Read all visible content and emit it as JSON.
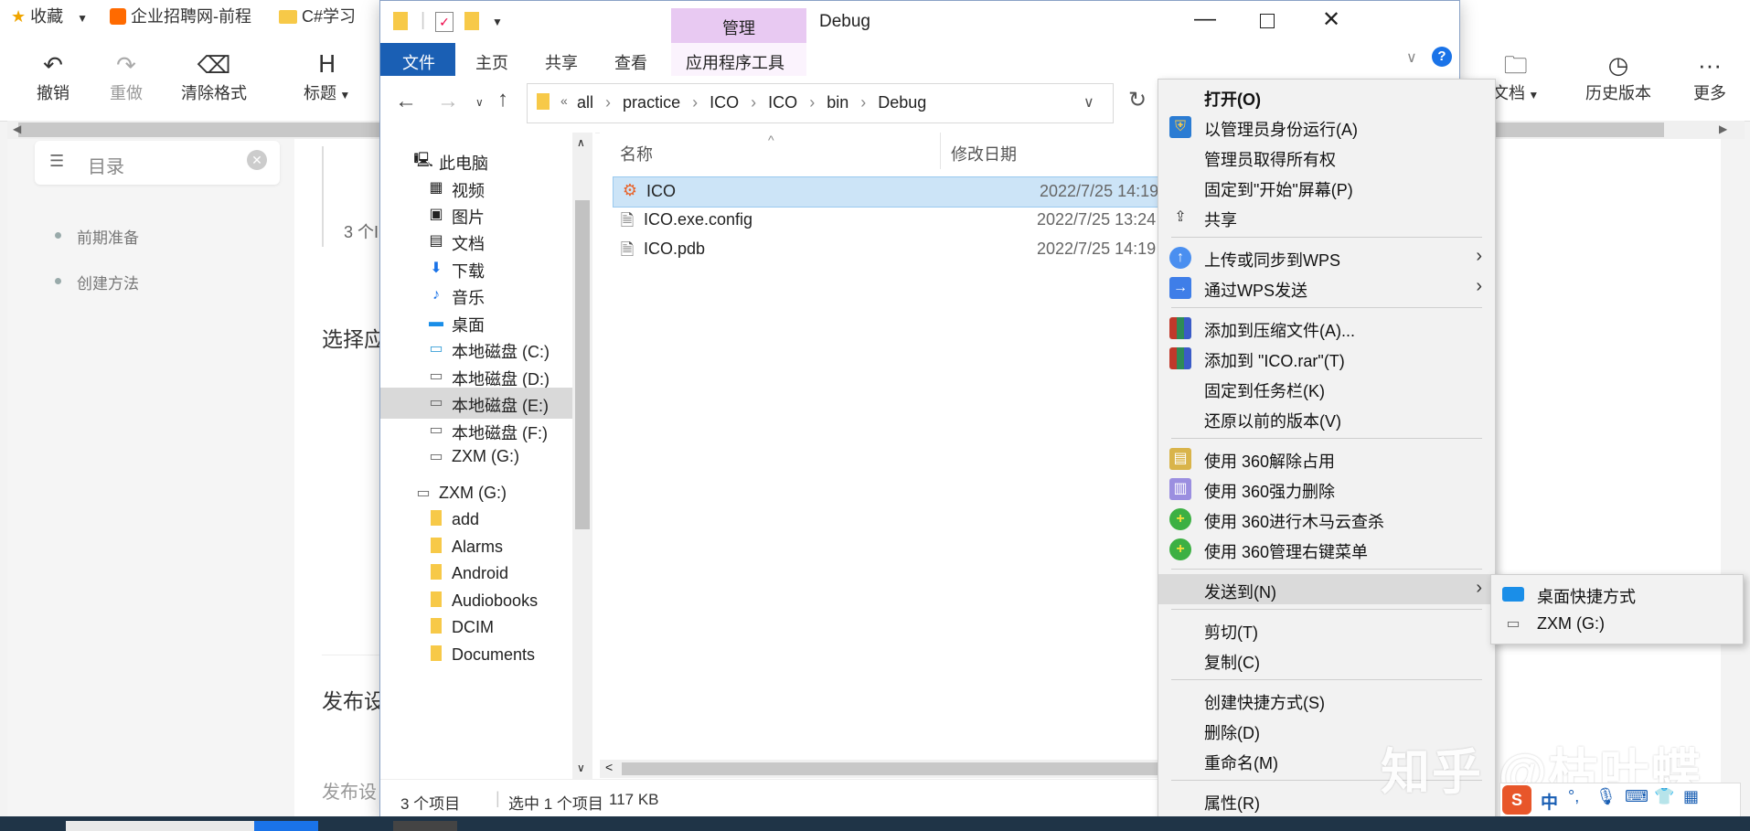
{
  "bookmarks": {
    "items": [
      {
        "label": "收藏",
        "icon": "star-icon"
      },
      {
        "label": "企业招聘网-前程",
        "icon": "job-site-icon"
      },
      {
        "label": "C#学习",
        "icon": "folder-icon"
      }
    ]
  },
  "editor_toolbar": {
    "undo": "撤销",
    "redo": "重做",
    "clear_format": "清除格式",
    "heading": "标题",
    "docs": "文档",
    "history": "历史版本",
    "more": "更多"
  },
  "toc": {
    "label": "目录",
    "items": [
      "前期准备",
      "创建方法"
    ]
  },
  "doc": {
    "count_fragment": "3 个I",
    "select_fragment": "选择应",
    "publish_fragment": "发布设",
    "publish_fragment2": "发布设"
  },
  "explorer": {
    "title": "Debug",
    "context_tab_header": "管理",
    "ribbon_tabs": [
      "文件",
      "主页",
      "共享",
      "查看",
      "应用程序工具"
    ],
    "breadcrumb": [
      "all",
      "practice",
      "ICO",
      "ICO",
      "bin",
      "Debug"
    ],
    "breadcrumb_prefix": "«",
    "nav": {
      "this_pc": "此电脑",
      "items": [
        {
          "label": "视频",
          "icon": "video-icon"
        },
        {
          "label": "图片",
          "icon": "pictures-icon"
        },
        {
          "label": "文档",
          "icon": "documents-icon"
        },
        {
          "label": "下载",
          "icon": "download-icon"
        },
        {
          "label": "音乐",
          "icon": "music-icon"
        },
        {
          "label": "桌面",
          "icon": "desktop-icon"
        },
        {
          "label": "本地磁盘 (C:)",
          "icon": "drive-c-icon"
        },
        {
          "label": "本地磁盘 (D:)",
          "icon": "drive-icon"
        },
        {
          "label": "本地磁盘 (E:)",
          "icon": "drive-icon",
          "selected": true
        },
        {
          "label": "本地磁盘 (F:)",
          "icon": "drive-icon"
        },
        {
          "label": "ZXM (G:)",
          "icon": "usb-drive-icon"
        }
      ],
      "zxm_root": "ZXM (G:)",
      "folders": [
        "add",
        "Alarms",
        "Android",
        "Audiobooks",
        "DCIM",
        "Documents"
      ]
    },
    "columns": {
      "name": "名称",
      "modified": "修改日期"
    },
    "files": [
      {
        "name": "ICO",
        "date": "2022/7/25 14:19",
        "icon": "exe-gear-icon",
        "selected": true
      },
      {
        "name": "ICO.exe.config",
        "date": "2022/7/25 13:24",
        "icon": "config-file-icon"
      },
      {
        "name": "ICO.pdb",
        "date": "2022/7/25 14:19",
        "icon": "pdb-file-icon"
      }
    ],
    "status": {
      "count": "3 个项目",
      "selected": "选中 1 个项目",
      "size": "117 KB"
    }
  },
  "context_menu": {
    "items": [
      {
        "label": "打开(O)",
        "bold": true
      },
      {
        "label": "以管理员身份运行(A)",
        "icon": "shield-icon"
      },
      {
        "label": "管理员取得所有权"
      },
      {
        "label": "固定到\"开始\"屏幕(P)"
      },
      {
        "label": "共享",
        "icon": "share-icon"
      },
      {
        "label": "上传或同步到WPS",
        "icon": "cloud-upload-icon",
        "submenu": true
      },
      {
        "label": "通过WPS发送",
        "icon": "wps-send-icon",
        "submenu": true
      },
      {
        "label": "添加到压缩文件(A)...",
        "icon": "winrar-icon"
      },
      {
        "label": "添加到 \"ICO.rar\"(T)",
        "icon": "winrar-icon"
      },
      {
        "label": "固定到任务栏(K)"
      },
      {
        "label": "还原以前的版本(V)"
      },
      {
        "label": "使用 360解除占用",
        "icon": "unlock-360-icon"
      },
      {
        "label": "使用 360强力删除",
        "icon": "shred-360-icon"
      },
      {
        "label": "使用 360进行木马云查杀",
        "icon": "scan-360-icon"
      },
      {
        "label": "使用 360管理右键菜单",
        "icon": "menu-360-icon"
      },
      {
        "label": "发送到(N)",
        "submenu": true,
        "highlighted": true
      },
      {
        "label": "剪切(T)"
      },
      {
        "label": "复制(C)"
      },
      {
        "label": "创建快捷方式(S)"
      },
      {
        "label": "删除(D)"
      },
      {
        "label": "重命名(M)"
      },
      {
        "label": "属性(R)"
      }
    ]
  },
  "send_to_submenu": {
    "items": [
      {
        "label": "桌面快捷方式",
        "icon": "desktop-icon"
      },
      {
        "label": "ZXM (G:)",
        "icon": "usb-drive-icon"
      }
    ]
  },
  "watermark": "知乎 @枯叶蝶",
  "ime": {
    "label": "中"
  }
}
